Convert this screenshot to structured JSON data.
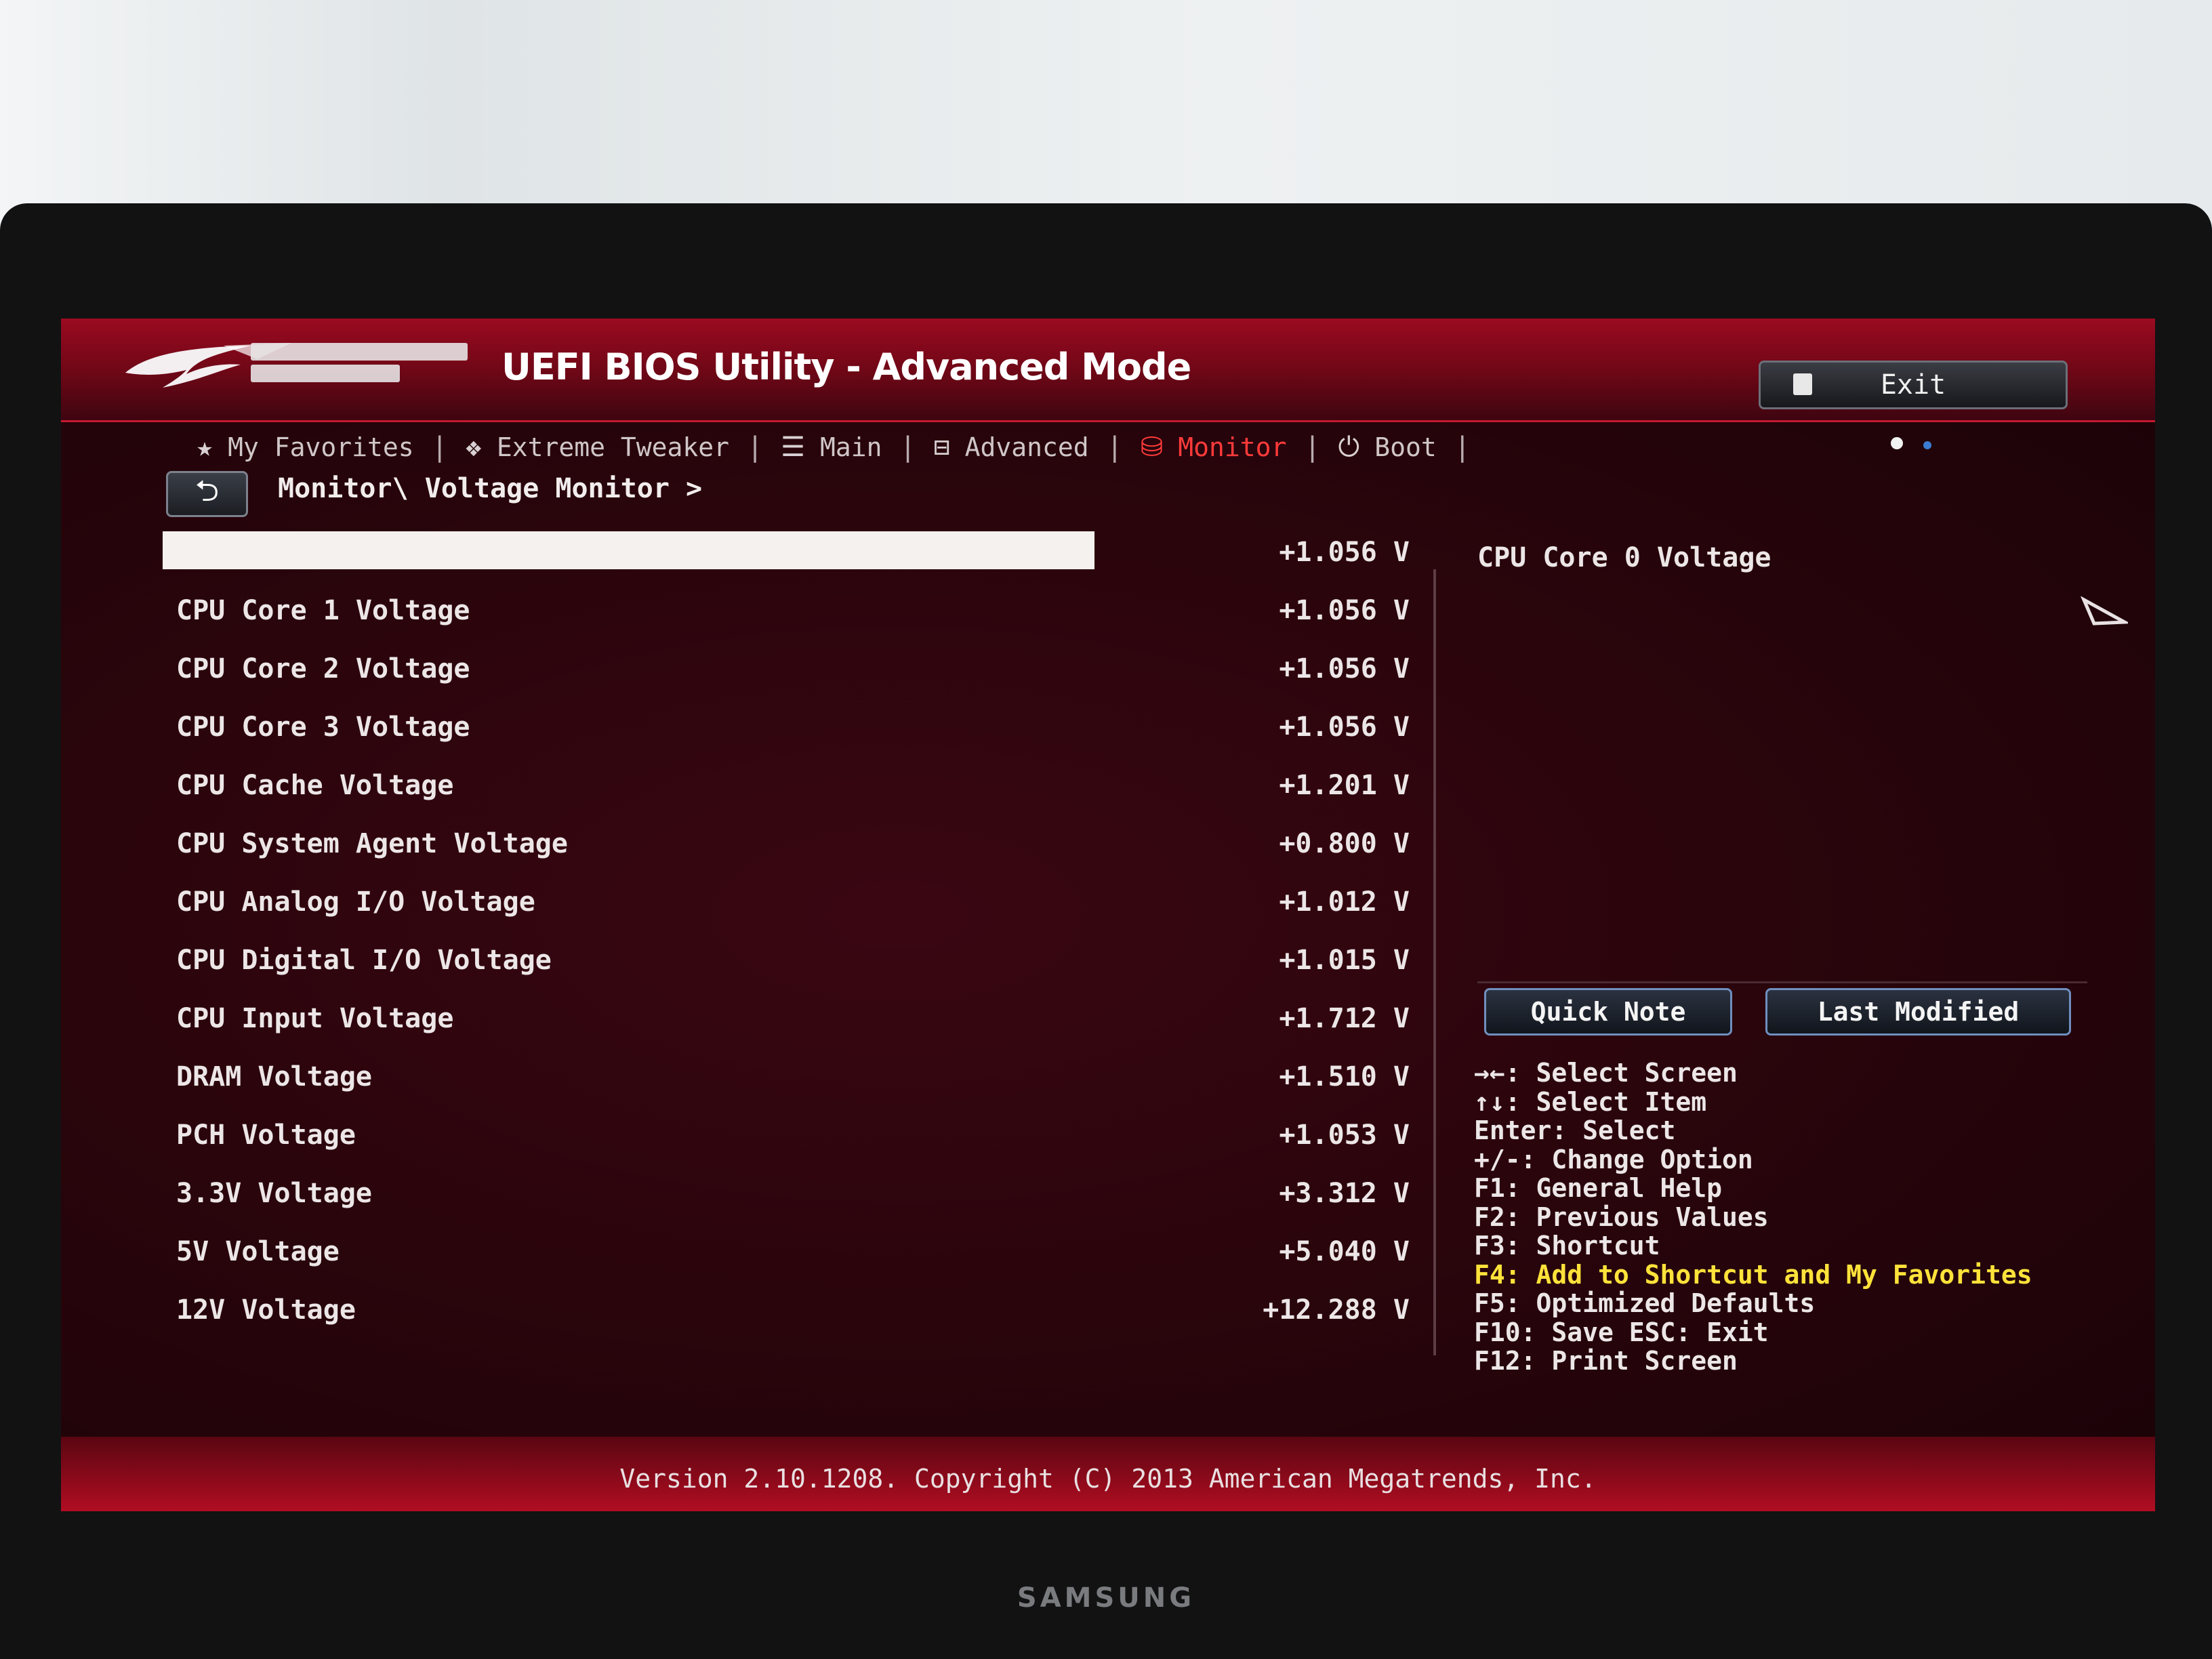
{
  "header": {
    "title": "UEFI BIOS Utility - Advanced Mode",
    "exit_label": "Exit",
    "brand_accent": "#9b0a20"
  },
  "tabs": [
    {
      "label": "My Favorites",
      "icon": "star-icon"
    },
    {
      "label": "Extreme Tweaker",
      "icon": "tweaker-icon"
    },
    {
      "label": "Main",
      "icon": "list-icon"
    },
    {
      "label": "Advanced",
      "icon": "advanced-icon"
    },
    {
      "label": "Monitor",
      "icon": "monitor-icon",
      "active": true
    },
    {
      "label": "Boot",
      "icon": "power-icon"
    }
  ],
  "breadcrumb": "Monitor\\ Voltage Monitor >",
  "voltages": [
    {
      "label": "",
      "value": "+1.056 V",
      "selected": true
    },
    {
      "label": "CPU Core 1 Voltage",
      "value": "+1.056 V"
    },
    {
      "label": "CPU Core 2 Voltage",
      "value": "+1.056 V"
    },
    {
      "label": "CPU Core 3 Voltage",
      "value": "+1.056 V"
    },
    {
      "label": "CPU Cache Voltage",
      "value": "+1.201 V"
    },
    {
      "label": "CPU System Agent Voltage",
      "value": "+0.800 V"
    },
    {
      "label": "CPU Analog I/O Voltage",
      "value": "+1.012 V"
    },
    {
      "label": "CPU Digital I/O Voltage",
      "value": "+1.015 V"
    },
    {
      "label": "CPU Input Voltage",
      "value": "+1.712 V"
    },
    {
      "label": "DRAM Voltage",
      "value": "+1.510 V"
    },
    {
      "label": "PCH Voltage",
      "value": "+1.053 V"
    },
    {
      "label": "3.3V Voltage",
      "value": "+3.312 V"
    },
    {
      "label": "5V Voltage",
      "value": "+5.040 V"
    },
    {
      "label": "12V Voltage",
      "value": "+12.288 V"
    }
  ],
  "help_panel": {
    "title": "CPU Core 0 Voltage",
    "quick_note": "Quick Note",
    "last_modified": "Last Modified",
    "keys": [
      {
        "text": "→←: Select Screen"
      },
      {
        "text": "↑↓: Select Item"
      },
      {
        "text": "Enter: Select"
      },
      {
        "text": "+/-: Change Option"
      },
      {
        "text": "F1: General Help"
      },
      {
        "text": "F2: Previous Values"
      },
      {
        "text": "F3: Shortcut"
      },
      {
        "text": "F4: Add to Shortcut and My Favorites",
        "highlight": true
      },
      {
        "text": "F5: Optimized Defaults"
      },
      {
        "text": "F10: Save  ESC: Exit"
      },
      {
        "text": "F12: Print Screen"
      }
    ]
  },
  "footer": {
    "version": "Version 2.10.1208. Copyright (C) 2013 American Megatrends, Inc."
  },
  "monitor_brand": "SAMSUNG",
  "colors": {
    "active_tab": "#ff3a3a",
    "f4_highlight": "#ffe23a",
    "dot_white": "#f2f2f2",
    "dot_blue": "#3a7ccf"
  }
}
